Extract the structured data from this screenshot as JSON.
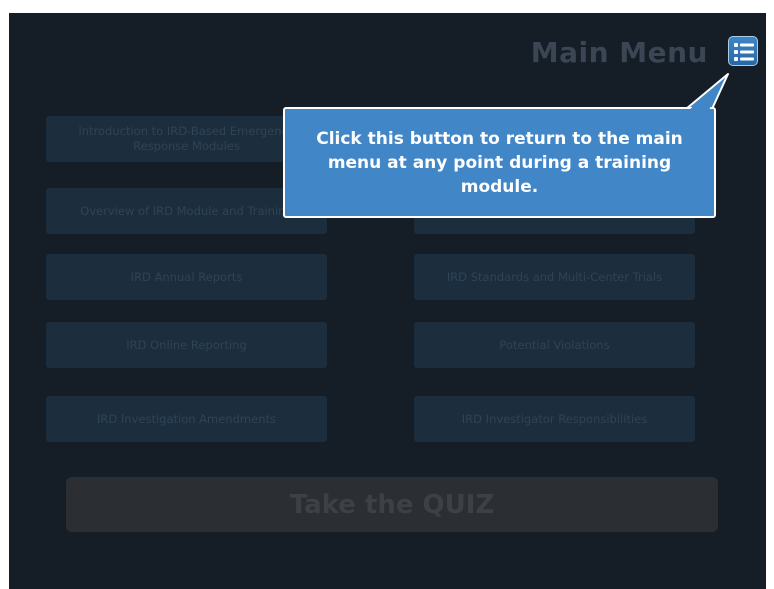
{
  "header": {
    "title": "Main Menu",
    "menu_icon": "list-menu-icon"
  },
  "modules": [
    {
      "label": "Introduction to IRD-Based Emergency Response Modules",
      "row": 1,
      "col": 1
    },
    {
      "label": "",
      "row": 1,
      "col": 2
    },
    {
      "label": "Overview of IRD Module and Training",
      "row": 2,
      "col": 1
    },
    {
      "label": "",
      "row": 2,
      "col": 2
    },
    {
      "label": "IRD Annual Reports",
      "row": 3,
      "col": 1
    },
    {
      "label": "IRD Standards and Multi-Center Trials",
      "row": 3,
      "col": 2
    },
    {
      "label": "IRD Online Reporting",
      "row": 4,
      "col": 1
    },
    {
      "label": "Potential Violations",
      "row": 4,
      "col": 2
    },
    {
      "label": "IRD Investigation Amendments",
      "row": 5,
      "col": 1
    },
    {
      "label": "IRD Investigator Responsibilities",
      "row": 5,
      "col": 2
    }
  ],
  "quiz": {
    "label": "Take the QUIZ"
  },
  "callout": {
    "text": "Click this button to return to the main menu at any point during a training module."
  },
  "colors": {
    "background": "#151d26",
    "module": "#1c2d3d",
    "callout": "#4186c6",
    "menu_button": "#2e72b3"
  }
}
